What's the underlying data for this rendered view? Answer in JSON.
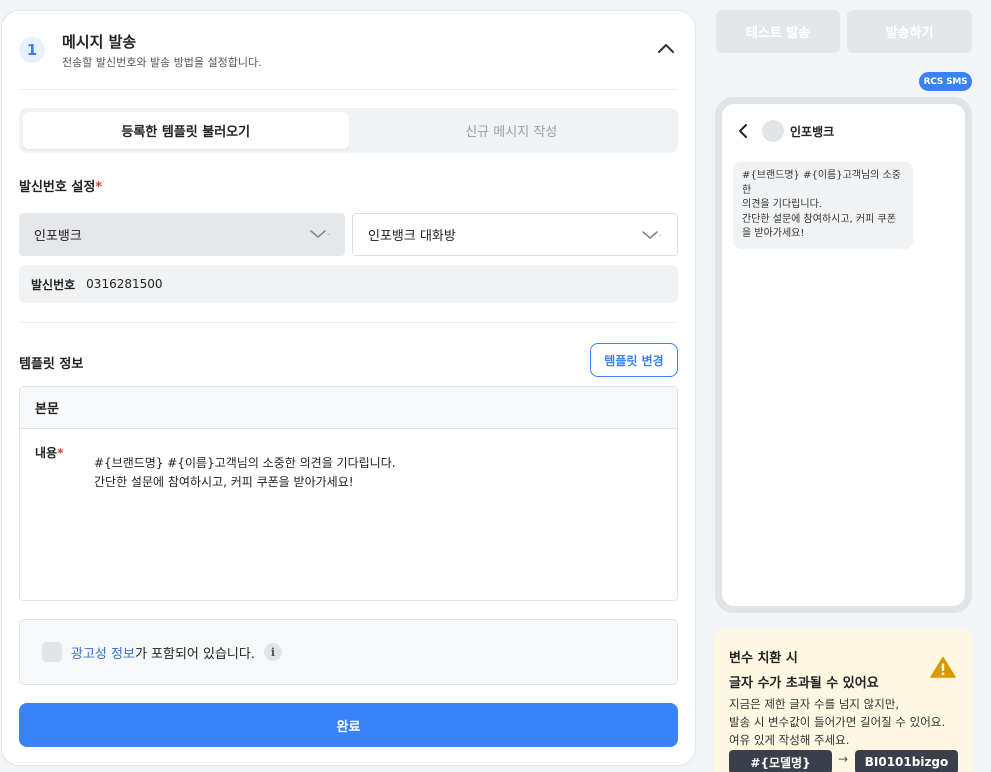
{
  "step": {
    "number": "1",
    "title": "메시지 발송",
    "subtitle": "전송할 발신번호와 발송 방법을 설정합니다."
  },
  "tabs": [
    {
      "label": "등록한 템플릿 불러오기",
      "active": true
    },
    {
      "label": "신규 메시지 작성",
      "active": false
    }
  ],
  "sender_settings": {
    "label": "발신번호 설정",
    "required_mark": "*",
    "channel_select": "인포뱅크",
    "room_select": "인포뱅크 대화방",
    "number_key": "발신번호",
    "number_value": "0316281500"
  },
  "template": {
    "label": "템플릿 정보",
    "change_button": "템플릿 변경",
    "body_header": "본문",
    "content_label": "내용",
    "required_mark": "*",
    "content_text": "#{브랜드명} #{이름}고객님의 소중한 의견을 기다립니다.\n간단한 설문에 참여하시고, 커피 쿠폰을 받아가세요!"
  },
  "ad": {
    "link_text": "광고성 정보",
    "rest_text": "가 포함되어 있습니다.",
    "info_icon": "i"
  },
  "complete_button": "완료",
  "right_panel": {
    "test_button": "테스트 발송",
    "send_button": "발송하기",
    "badge": "RCS SMS",
    "preview": {
      "chat_name": "인포뱅크",
      "message": "#{브랜드명} #{이름}고객님의 소중한\n의견을 기다립니다.\n간단한 설문에 참여하시고, 커피 쿠폰\n을 받아가세요!"
    },
    "warning": {
      "title_line1": "변수 치환 시",
      "title_line2": "글자 수가 초과될 수 있어요",
      "body": "지금은 제한 글자 수를 넘지 않지만,\n발송 시 변수값이 들어가면 길어질 수 있어요.\n여유 있게 작성해 주세요.",
      "chip_from": "#{모델명}",
      "arrow": "→",
      "chip_to": "BI0101bizgo"
    }
  },
  "colors": {
    "accent": "#3a82f7",
    "warning_bg": "#fef8e3",
    "warning_icon": "#d89a00"
  }
}
